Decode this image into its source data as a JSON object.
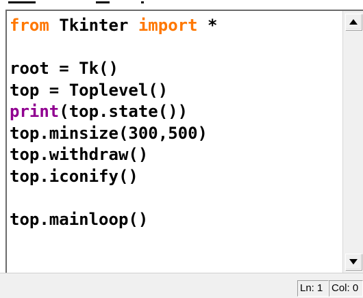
{
  "editor": {
    "lines": [
      [
        {
          "cls": "kw",
          "text": "from"
        },
        {
          "cls": "txt",
          "text": " Tkinter "
        },
        {
          "cls": "kw",
          "text": "import"
        },
        {
          "cls": "txt",
          "text": " *"
        }
      ],
      [],
      [
        {
          "cls": "txt",
          "text": "root = Tk()"
        }
      ],
      [
        {
          "cls": "txt",
          "text": "top = Toplevel()"
        }
      ],
      [
        {
          "cls": "bi",
          "text": "print"
        },
        {
          "cls": "txt",
          "text": "(top.state())"
        }
      ],
      [
        {
          "cls": "txt",
          "text": "top.minsize(300,500)"
        }
      ],
      [
        {
          "cls": "txt",
          "text": "top.withdraw()"
        }
      ],
      [
        {
          "cls": "txt",
          "text": "top.iconify()"
        }
      ],
      [],
      [
        {
          "cls": "txt",
          "text": "top.mainloop()"
        }
      ]
    ]
  },
  "scrollbar": {
    "up_icon": "triangle-up-icon",
    "down_icon": "triangle-down-icon"
  },
  "status": {
    "line": "Ln: 1",
    "col": "Col: 0"
  },
  "colors": {
    "keyword": "#ff7700",
    "builtin": "#900090",
    "text": "#000000"
  }
}
